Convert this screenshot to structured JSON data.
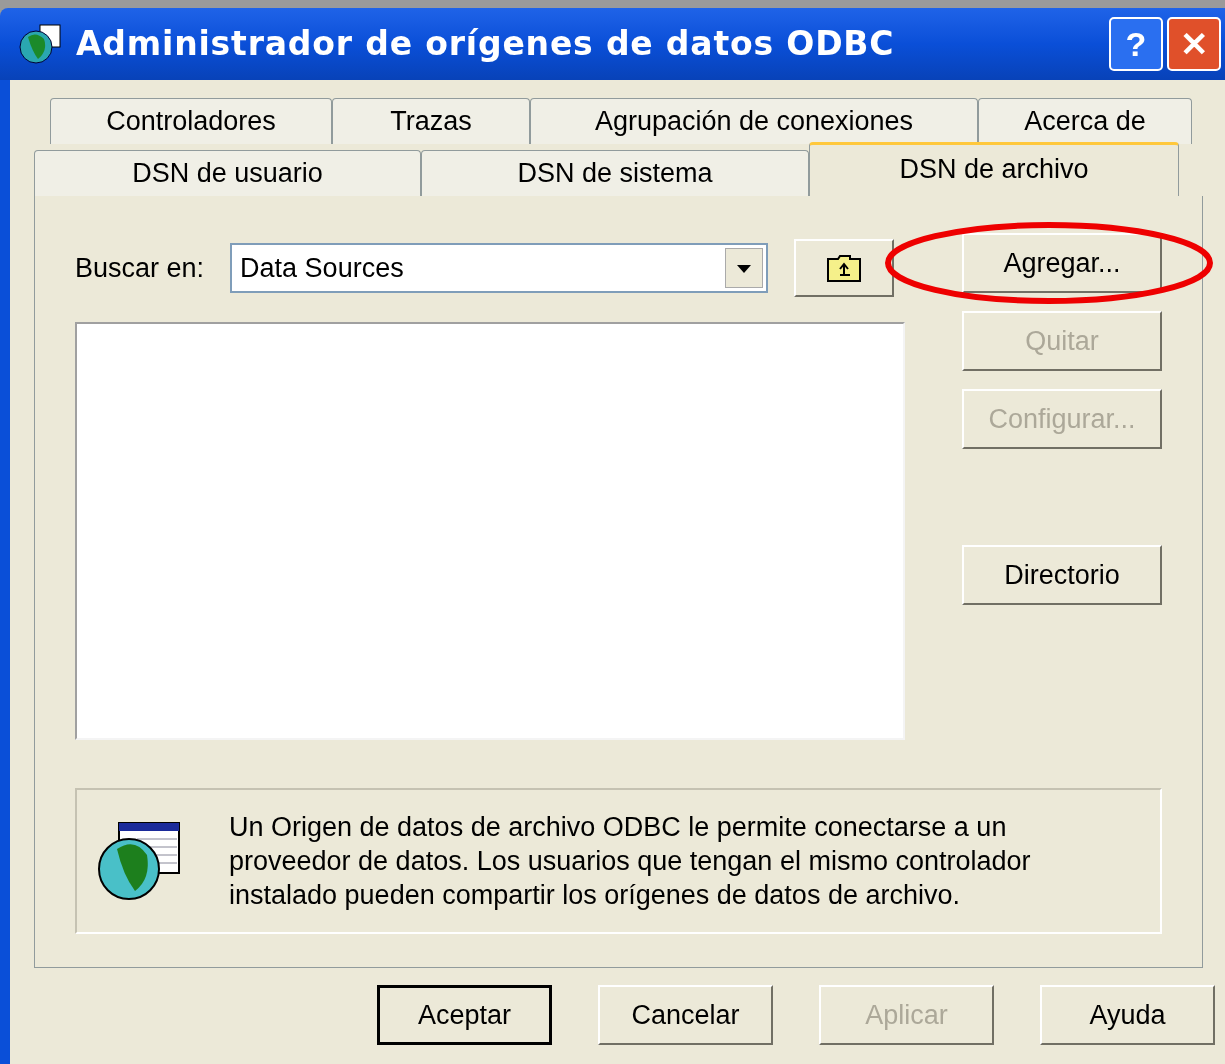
{
  "window": {
    "title": "Administrador de orígenes de datos ODBC",
    "title_buttons": [
      {
        "kind": "help",
        "glyph": "?"
      },
      {
        "kind": "close",
        "glyph": "✕"
      }
    ]
  },
  "tab_rows": [
    [
      {
        "label": "Controladores",
        "selected": false
      },
      {
        "label": "Trazas",
        "selected": false
      },
      {
        "label": "Agrupación de conexiones",
        "selected": false
      },
      {
        "label": "Acerca de",
        "selected": false
      }
    ],
    [
      {
        "label": "DSN de usuario",
        "selected": false
      },
      {
        "label": "DSN de sistema",
        "selected": false
      },
      {
        "label": "DSN de archivo",
        "selected": true
      }
    ]
  ],
  "look_in": {
    "label": "Buscar en:",
    "value": "Data Sources"
  },
  "side_buttons": [
    {
      "kind": "button",
      "label": "Agregar...",
      "disabled": false,
      "circled": true
    },
    {
      "kind": "button",
      "label": "Quitar",
      "disabled": true,
      "circled": false
    },
    {
      "kind": "button",
      "label": "Configurar...",
      "disabled": true,
      "circled": false
    },
    {
      "kind": "spacer"
    },
    {
      "kind": "button",
      "label": "Directorio",
      "disabled": false,
      "circled": false
    }
  ],
  "info": "Un Origen de datos de archivo ODBC le permite conectarse a un proveedor de datos. Los usuarios que tengan el mismo controlador instalado pueden compartir los orígenes de datos de archivo.",
  "footer_buttons": [
    {
      "label": "Aceptar",
      "disabled": false,
      "default": true
    },
    {
      "label": "Cancelar",
      "disabled": false,
      "default": false
    },
    {
      "label": "Aplicar",
      "disabled": true,
      "default": false
    },
    {
      "label": "Ayuda",
      "disabled": false,
      "default": false
    }
  ]
}
